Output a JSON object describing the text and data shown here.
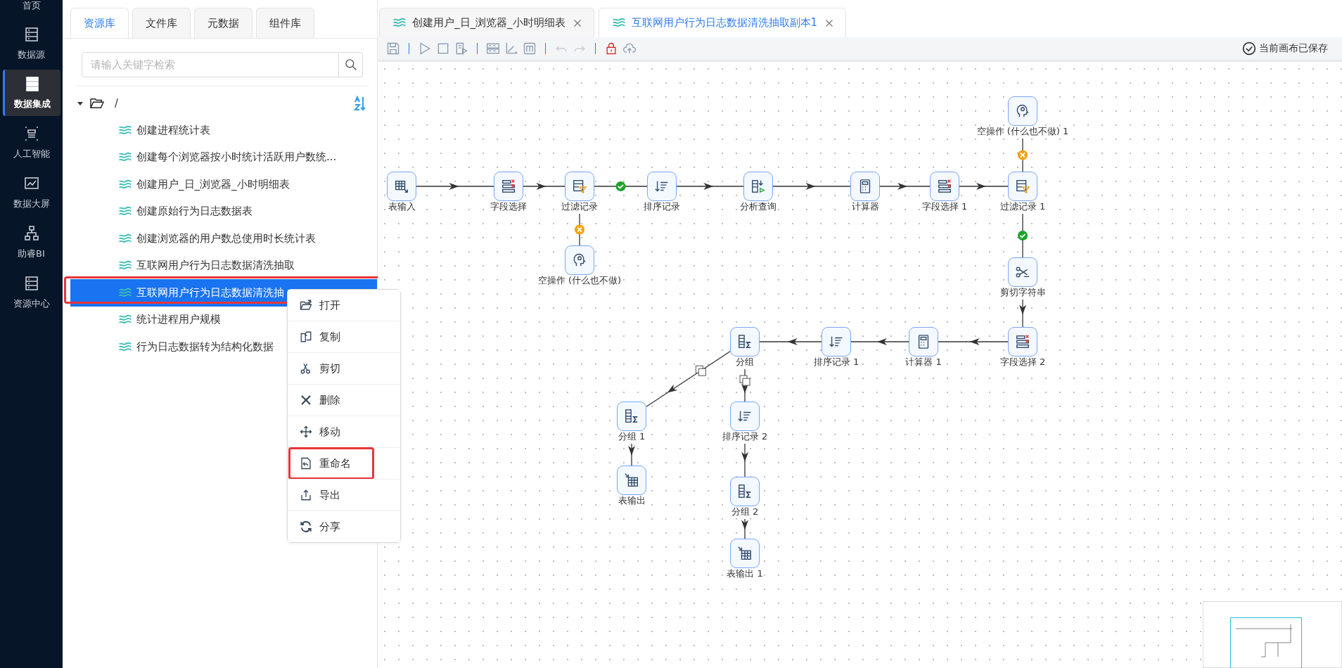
{
  "nav": [
    {
      "label": "首页",
      "selected": false
    },
    {
      "label": "数据源",
      "selected": false
    },
    {
      "label": "数据集成",
      "selected": true
    },
    {
      "label": "人工智能",
      "selected": false
    },
    {
      "label": "数据大屏",
      "selected": false
    },
    {
      "label": "助睿BI",
      "selected": false
    },
    {
      "label": "资源中心",
      "selected": false
    }
  ],
  "panel_tabs": [
    {
      "label": "资源库",
      "selected": true
    },
    {
      "label": "文件库",
      "selected": false
    },
    {
      "label": "元数据",
      "selected": false
    },
    {
      "label": "组件库",
      "selected": false
    }
  ],
  "search": {
    "placeholder": "请输入关键字检索"
  },
  "tree": {
    "label": "/",
    "expanded": true,
    "children": [
      {
        "label": "创建进程统计表",
        "selected": false,
        "annotated": false
      },
      {
        "label": "创建每个浏览器按小时统计活跃用户数统...",
        "selected": false,
        "annotated": false
      },
      {
        "label": "创建用户_日_浏览器_小时明细表",
        "selected": false,
        "annotated": false
      },
      {
        "label": "创建原始行为日志数据表",
        "selected": false,
        "annotated": false
      },
      {
        "label": "创建浏览器的用户数总使用时长统计表",
        "selected": false,
        "annotated": false
      },
      {
        "label": "互联网用户行为日志数据清洗抽取",
        "selected": false,
        "annotated": false
      },
      {
        "label": "互联网用户行为日志数据清洗抽",
        "selected": true,
        "annotated": true
      },
      {
        "label": "统计进程用户规模",
        "selected": false,
        "annotated": false
      },
      {
        "label": "行为日志数据转为结构化数据",
        "selected": false,
        "annotated": false
      }
    ]
  },
  "editor_tabs": [
    {
      "label": "创建用户_日_浏览器_小时明细表",
      "selected": false
    },
    {
      "label": "互联网用户行为日志数据清洗抽取副本1",
      "selected": true
    }
  ],
  "save_status": "当前画布已保存",
  "canvas": {
    "nodes": [
      {
        "label": "空操作 (什么也不做) 1",
        "kind": "dummy"
      },
      {
        "label": "表输入",
        "kind": "table_input"
      },
      {
        "label": "字段选择",
        "kind": "select"
      },
      {
        "label": "过滤记录",
        "kind": "filter"
      },
      {
        "label": "排序记录",
        "kind": "sort"
      },
      {
        "label": "分析查询",
        "kind": "analytic"
      },
      {
        "label": "计算器",
        "kind": "calculator"
      },
      {
        "label": "字段选择 1",
        "kind": "select"
      },
      {
        "label": "过滤记录 1",
        "kind": "filter"
      },
      {
        "label": "空操作 (什么也不做)",
        "kind": "dummy"
      },
      {
        "label": "剪切字符串",
        "kind": "cut"
      },
      {
        "label": "分组",
        "kind": "group"
      },
      {
        "label": "排序记录 1",
        "kind": "sort"
      },
      {
        "label": "计算器 1",
        "kind": "calculator"
      },
      {
        "label": "字段选择 2",
        "kind": "select"
      },
      {
        "label": "分组 1",
        "kind": "group"
      },
      {
        "label": "排序记录 2",
        "kind": "sort"
      },
      {
        "label": "表输出",
        "kind": "table_output"
      },
      {
        "label": "分组 2",
        "kind": "group"
      },
      {
        "label": "表输出 1",
        "kind": "table_output"
      }
    ]
  },
  "context_menu": {
    "items": [
      {
        "label": "打开",
        "annotated": false
      },
      {
        "label": "复制",
        "annotated": false
      },
      {
        "label": "剪切",
        "annotated": false
      },
      {
        "label": "删除",
        "annotated": false
      },
      {
        "label": "移动",
        "annotated": false
      },
      {
        "label": "重命名",
        "annotated": true
      },
      {
        "label": "导出",
        "annotated": false
      },
      {
        "label": "分享",
        "annotated": false
      }
    ]
  }
}
